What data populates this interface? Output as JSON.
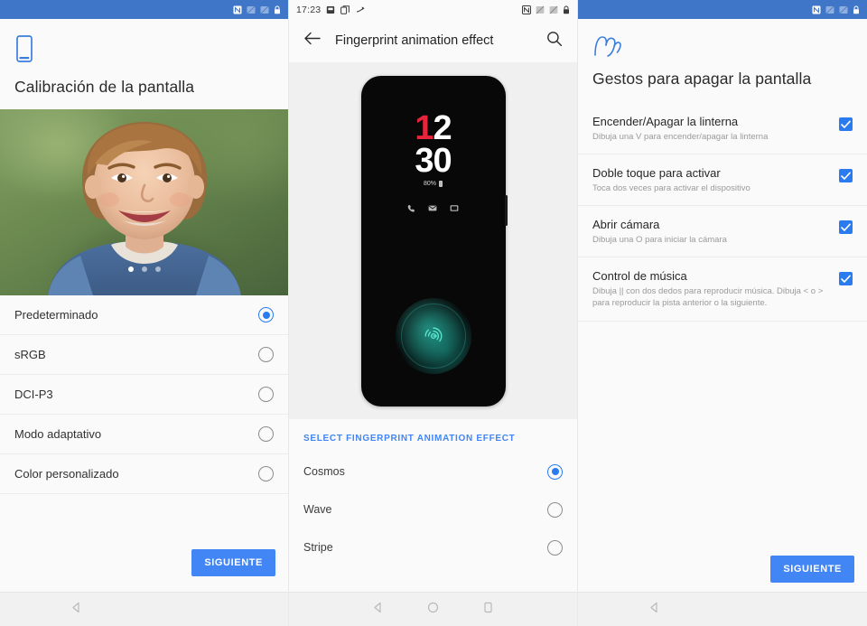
{
  "panel1": {
    "statusbar": {
      "icons": [
        "nfc-icon",
        "signal-muted-icon",
        "signal-muted-icon-2",
        "lock-icon"
      ]
    },
    "header_icon": "phone-screen-icon",
    "title": "Calibración de la pantalla",
    "photo": {
      "alt": "smiling-boy-photo",
      "dots": 3,
      "active_dot": 0
    },
    "options": [
      {
        "label": "Predeterminado",
        "selected": true
      },
      {
        "label": "sRGB",
        "selected": false
      },
      {
        "label": "DCI-P3",
        "selected": false
      },
      {
        "label": "Modo adaptativo",
        "selected": false
      },
      {
        "label": "Color personalizado",
        "selected": false
      }
    ],
    "next_label": "SIGUIENTE"
  },
  "panel2": {
    "statusbar": {
      "time": "17:23",
      "left_icons": [
        "sd-card-icon",
        "screenshot-icon",
        "share-icon"
      ],
      "right_icons": [
        "nfc-icon",
        "signal-muted-icon",
        "signal-muted-icon-2",
        "lock-icon"
      ]
    },
    "appbar": {
      "back_icon": "arrow-back-icon",
      "title": "Fingerprint animation effect",
      "search_icon": "search-icon"
    },
    "preview": {
      "hour": "12",
      "hour_accent_char": "1",
      "minute": "30",
      "battery": "80%",
      "notification_icons": [
        "phone-icon",
        "message-icon",
        "mail-icon"
      ],
      "fingerprint_icon": "fingerprint-icon",
      "effect": "Cosmos"
    },
    "section_header": "SELECT FINGERPRINT ANIMATION EFFECT",
    "options": [
      {
        "label": "Cosmos",
        "selected": true
      },
      {
        "label": "Wave",
        "selected": false
      },
      {
        "label": "Stripe",
        "selected": false
      }
    ]
  },
  "panel3": {
    "statusbar": {
      "icons": [
        "nfc-icon",
        "signal-muted-icon",
        "signal-muted-icon-2",
        "lock-icon"
      ]
    },
    "header_icon": "gesture-hand-icon",
    "title": "Gestos para apagar la pantalla",
    "gestures": [
      {
        "title": "Encender/Apagar la linterna",
        "subtitle": "Dibuja una V para encender/apagar la linterna",
        "checked": true
      },
      {
        "title": "Doble toque para activar",
        "subtitle": "Toca dos veces para activar el dispositivo",
        "checked": true
      },
      {
        "title": "Abrir cámara",
        "subtitle": "Dibuja una O para iniciar la cámara",
        "checked": true
      },
      {
        "title": "Control de música",
        "subtitle": "Dibuja || con dos dedos para reproducir música. Dibuja < o > para reproducir la pista anterior o la siguiente.",
        "checked": true
      }
    ],
    "next_label": "SIGUIENTE"
  },
  "navbar": {
    "back_icon": "back-triangle-icon",
    "home_icon": "home-circle-icon",
    "recents_icon": "recents-square-icon"
  },
  "colors": {
    "status_blue": "#4076c8",
    "accent_blue": "#4285f4",
    "radio_blue": "#2a7bf0",
    "section_blue": "#4285f4",
    "clock_red": "#e8243c",
    "cosmos_teal": "#3ce6cd"
  }
}
